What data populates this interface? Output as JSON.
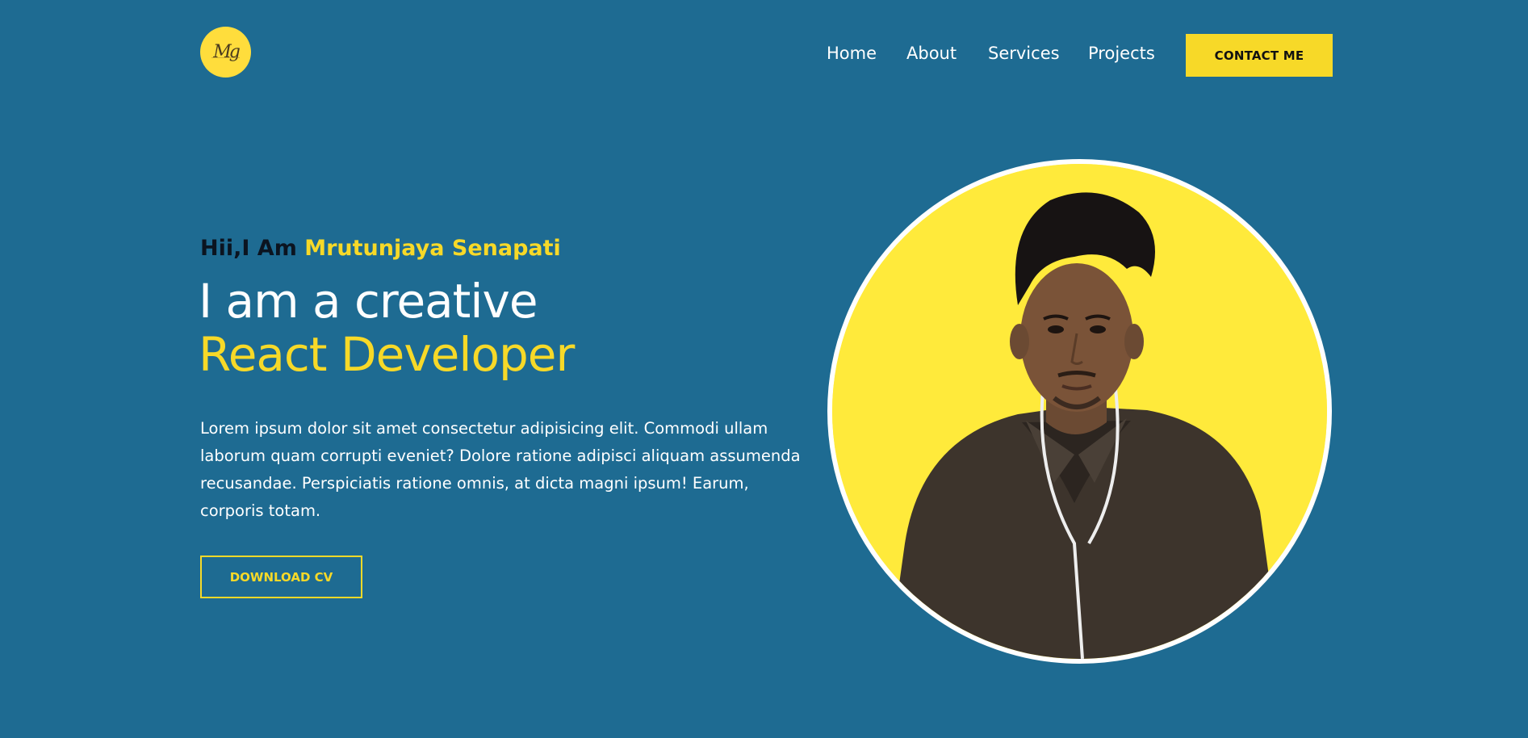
{
  "header": {
    "logo_text": "Mg",
    "nav": [
      {
        "label": "Home"
      },
      {
        "label": "About"
      },
      {
        "label": "Services"
      },
      {
        "label": "Projects"
      }
    ],
    "contact_label": "CONTACT ME"
  },
  "hero": {
    "greeting_prefix": "Hii,I Am",
    "name": "Mrutunjaya Senapati",
    "headline_line1": "I am a creative",
    "headline_line2": "React Developer",
    "description": "Lorem ipsum dolor sit amet consectetur adipisicing elit. Commodi ullam laborum quam corrupti eveniet? Dolore ratione adipisci aliquam assumenda recusandae. Perspiciatis ratione omnis, at dicta magni ipsum! Earum, corporis totam.",
    "download_label": "DOWNLOAD CV"
  },
  "colors": {
    "background": "#1e6b92",
    "accent": "#f7d928",
    "portrait_background": "#ffea3b"
  }
}
